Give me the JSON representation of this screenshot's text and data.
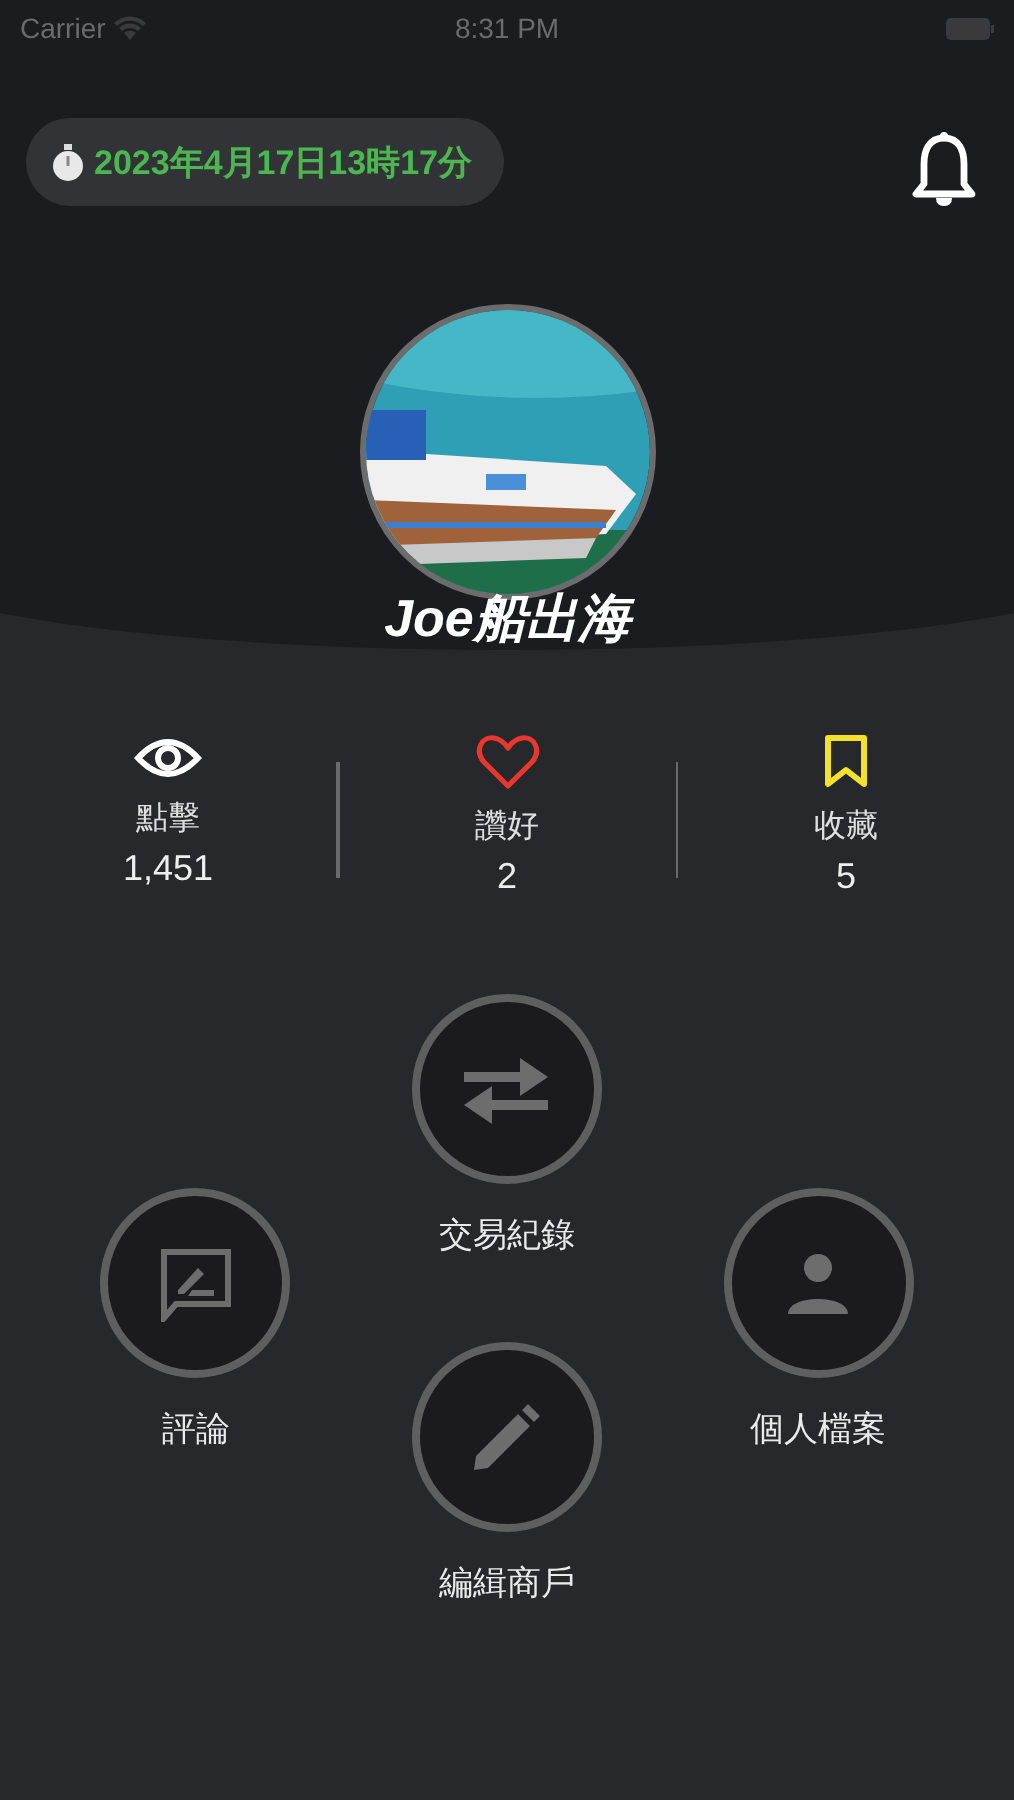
{
  "status_bar": {
    "carrier": "Carrier",
    "time": "8:31 PM"
  },
  "header": {
    "timestamp": "2023年4月17日13時17分"
  },
  "profile": {
    "name": "Joe船出海"
  },
  "stats": [
    {
      "kind": "views",
      "label": "點擊",
      "value": "1,451",
      "color": "#ffffff"
    },
    {
      "kind": "likes",
      "label": "讚好",
      "value": "2",
      "color": "#e8372c"
    },
    {
      "kind": "saves",
      "label": "收藏",
      "value": "5",
      "color": "#f2e22a"
    }
  ],
  "actions": [
    {
      "kind": "transfer",
      "label": "交易紀錄"
    },
    {
      "kind": "comment",
      "label": "評論"
    },
    {
      "kind": "profile",
      "label": "個人檔案"
    },
    {
      "kind": "edit",
      "label": "編緝商戶"
    }
  ]
}
